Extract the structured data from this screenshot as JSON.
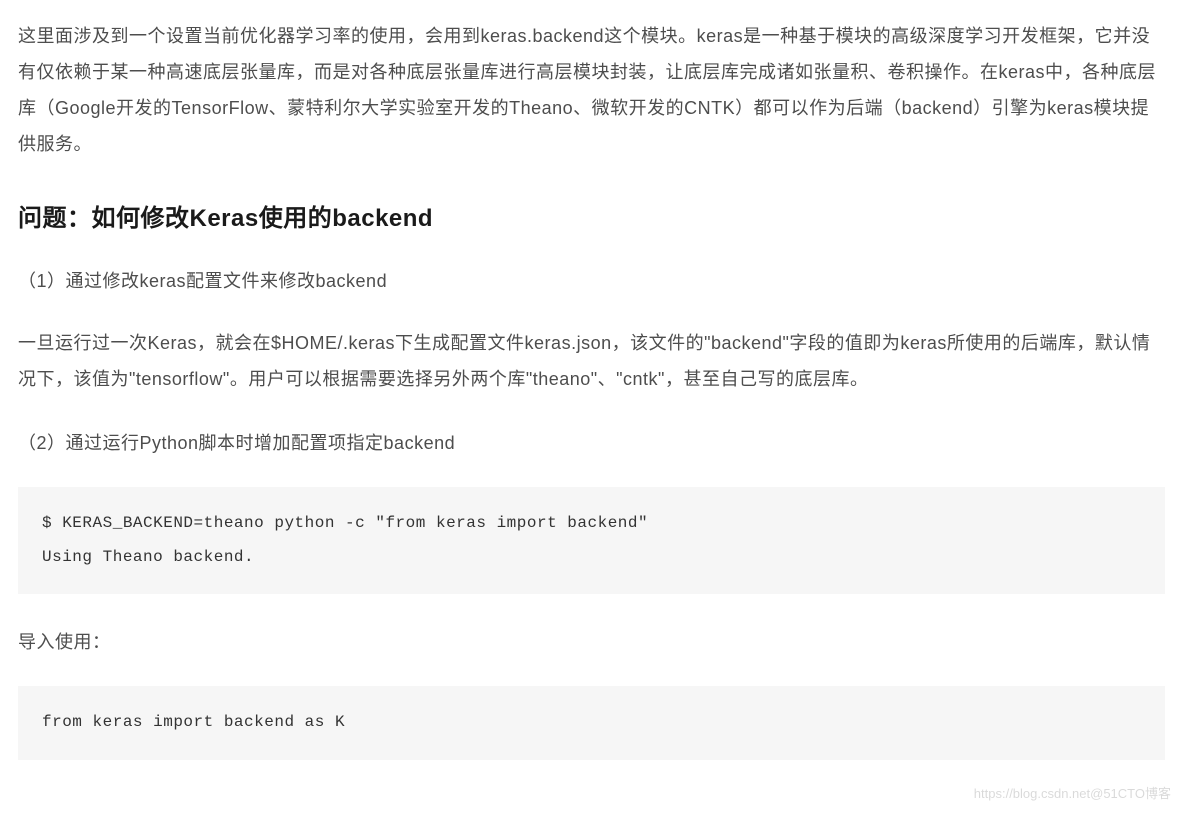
{
  "intro": "这里面涉及到一个设置当前优化器学习率的使用，会用到keras.backend这个模块。keras是一种基于模块的高级深度学习开发框架，它并没有仅依赖于某一种高速底层张量库，而是对各种底层张量库进行高层模块封装，让底层库完成诸如张量积、卷积操作。在keras中，各种底层库（Google开发的TensorFlow、蒙特利尔大学实验室开发的Theano、微软开发的CNTK）都可以作为后端（backend）引擎为keras模块提供服务。",
  "heading": "问题：如何修改Keras使用的backend",
  "method1_title": "（1）通过修改keras配置文件来修改backend",
  "method1_desc": "一旦运行过一次Keras，就会在$HOME/.keras下生成配置文件keras.json，该文件的\"backend\"字段的值即为keras所使用的后端库，默认情况下，该值为\"tensorflow\"。用户可以根据需要选择另外两个库\"theano\"、\"cntk\"，甚至自己写的底层库。",
  "method2_title": "（2）通过运行Python脚本时增加配置项指定backend",
  "code1": "$ KERAS_BACKEND=theano python -c \"from keras import backend\"\nUsing Theano backend.",
  "import_label": "导入使用：",
  "code2": "from keras import backend as K",
  "watermark": "https://blog.csdn.net@51CTO博客"
}
